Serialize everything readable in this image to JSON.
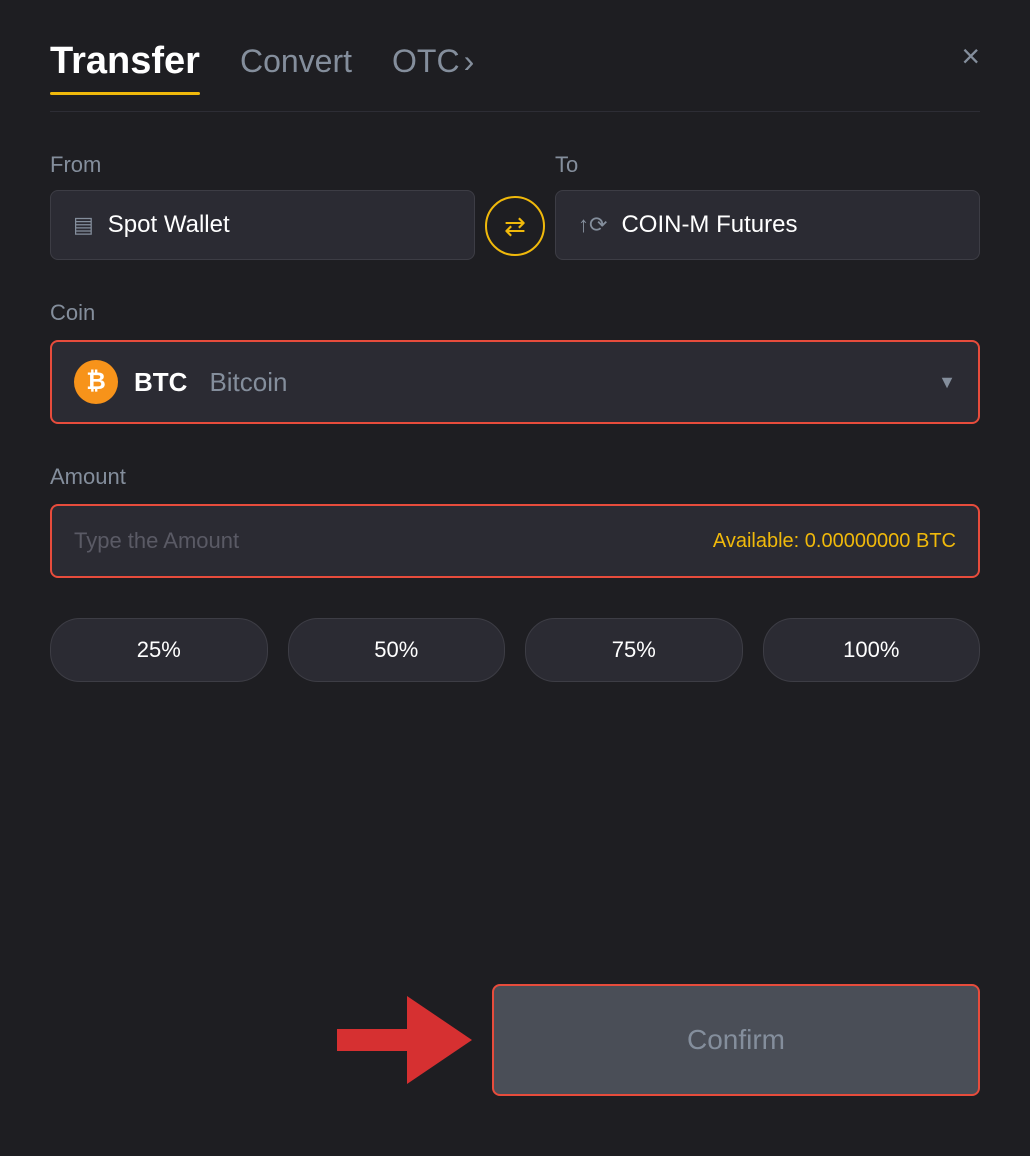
{
  "header": {
    "tab_transfer": "Transfer",
    "tab_convert": "Convert",
    "tab_otc": "OTC",
    "close_label": "×"
  },
  "from": {
    "label": "From",
    "wallet_name": "Spot Wallet"
  },
  "to": {
    "label": "To",
    "futures_name": "COIN-M Futures"
  },
  "coin": {
    "label": "Coin",
    "symbol": "BTC",
    "full_name": "Bitcoin"
  },
  "amount": {
    "label": "Amount",
    "placeholder": "Type the Amount",
    "available_label": "Available:",
    "available_value": "0.00000000 BTC"
  },
  "pct_buttons": [
    {
      "label": "25%"
    },
    {
      "label": "50%"
    },
    {
      "label": "75%"
    },
    {
      "label": "100%"
    }
  ],
  "confirm_button": {
    "label": "Confirm"
  }
}
